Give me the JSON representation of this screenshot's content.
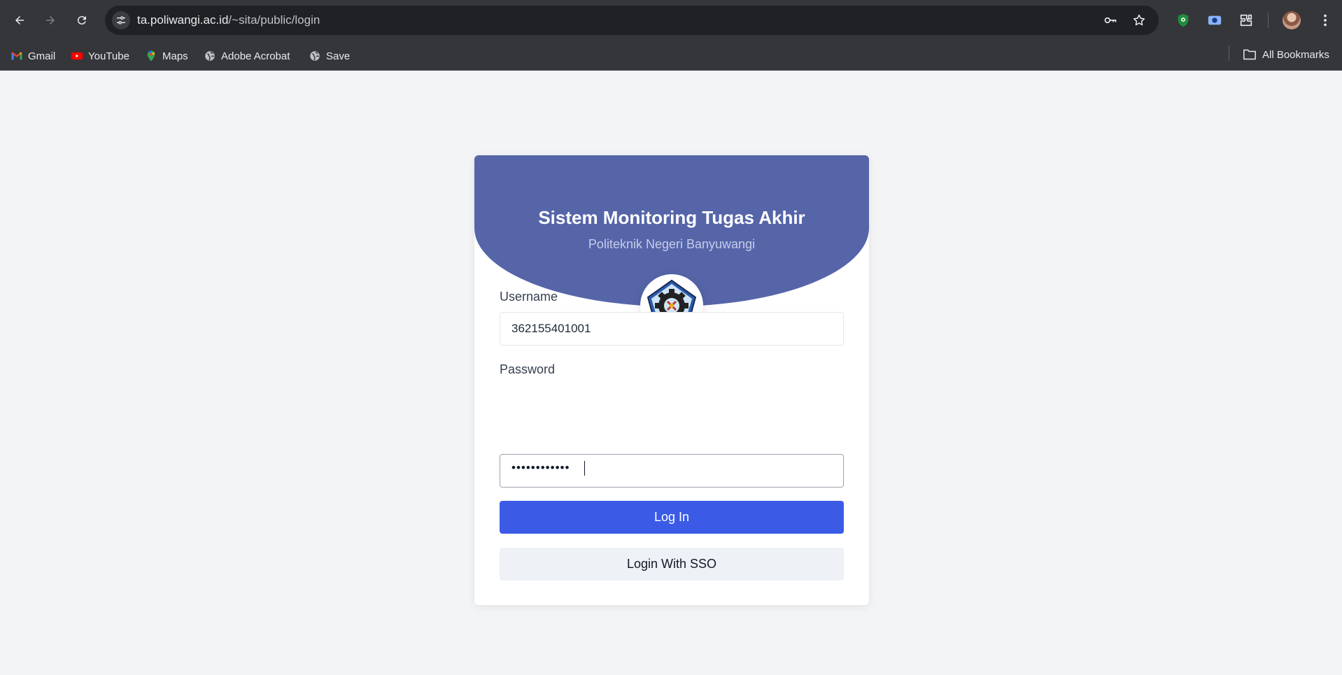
{
  "browser": {
    "url_host": "ta.poliwangi.ac.id",
    "url_path": "/~sita/public/login",
    "icons": {
      "back": "arrow-left-icon",
      "forward": "arrow-right-icon",
      "reload": "reload-icon",
      "site_info": "tune-icon",
      "password": "key-icon",
      "bookmark_star": "star-icon",
      "extension_shield": "shield-icon",
      "extension_screen": "screen-capture-icon",
      "extensions": "puzzle-icon",
      "menu": "kebab-menu-icon"
    }
  },
  "bookmarks": {
    "items": [
      {
        "label": "Gmail",
        "icon": "gmail-icon"
      },
      {
        "label": "YouTube",
        "icon": "youtube-icon"
      },
      {
        "label": "Maps",
        "icon": "maps-pin-icon"
      },
      {
        "label": "Adobe Acrobat",
        "icon": "globe-icon"
      },
      {
        "label": "Save",
        "icon": "globe-icon"
      }
    ],
    "all_label": "All Bookmarks"
  },
  "login": {
    "title": "Sistem Monitoring Tugas Akhir",
    "subtitle": "Politeknik Negeri Banyuwangi",
    "username_label": "Username",
    "username_value": "362155401001",
    "password_label": "Password",
    "password_masked": "••••••••••••",
    "login_button": "Log In",
    "sso_button": "Login With SSO"
  },
  "colors": {
    "header": "#5565a8",
    "primary_button": "#3b5be6",
    "secondary_button": "#eef1f6",
    "page_background": "#f3f4f6"
  }
}
